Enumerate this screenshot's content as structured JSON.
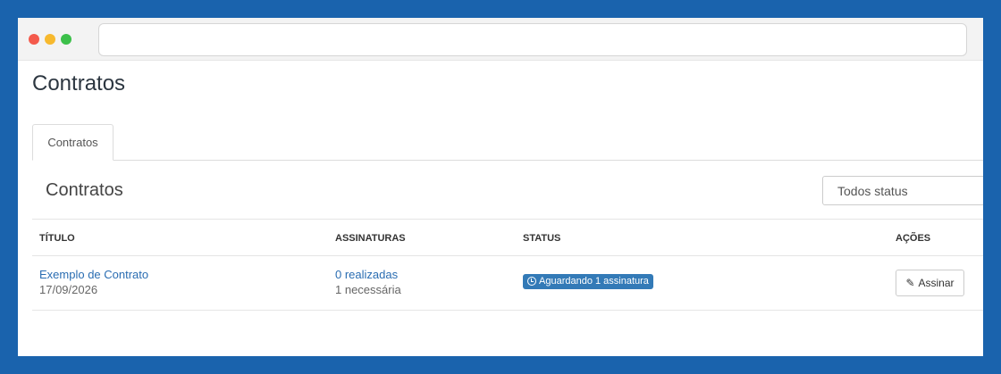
{
  "page": {
    "title": "Contratos"
  },
  "tabs": [
    {
      "label": "Contratos",
      "active": true
    }
  ],
  "section": {
    "title": "Contratos"
  },
  "filter": {
    "selected": "Todos status"
  },
  "table": {
    "headers": [
      "TÍTULO",
      "ASSINATURAS",
      "STATUS",
      "AÇÕES"
    ],
    "rows": [
      {
        "title": "Exemplo de Contrato",
        "date": "17/09/2026",
        "signed": "0 realizadas",
        "required": "1 necessária",
        "status": "Aguardando 1 assinatura",
        "status_icon": "clock-icon",
        "action": "Assinar",
        "action_icon": "pencil-icon"
      }
    ]
  },
  "colors": {
    "frame": "#1a63ad",
    "link": "#2a6db2",
    "badge": "#337ab7"
  }
}
